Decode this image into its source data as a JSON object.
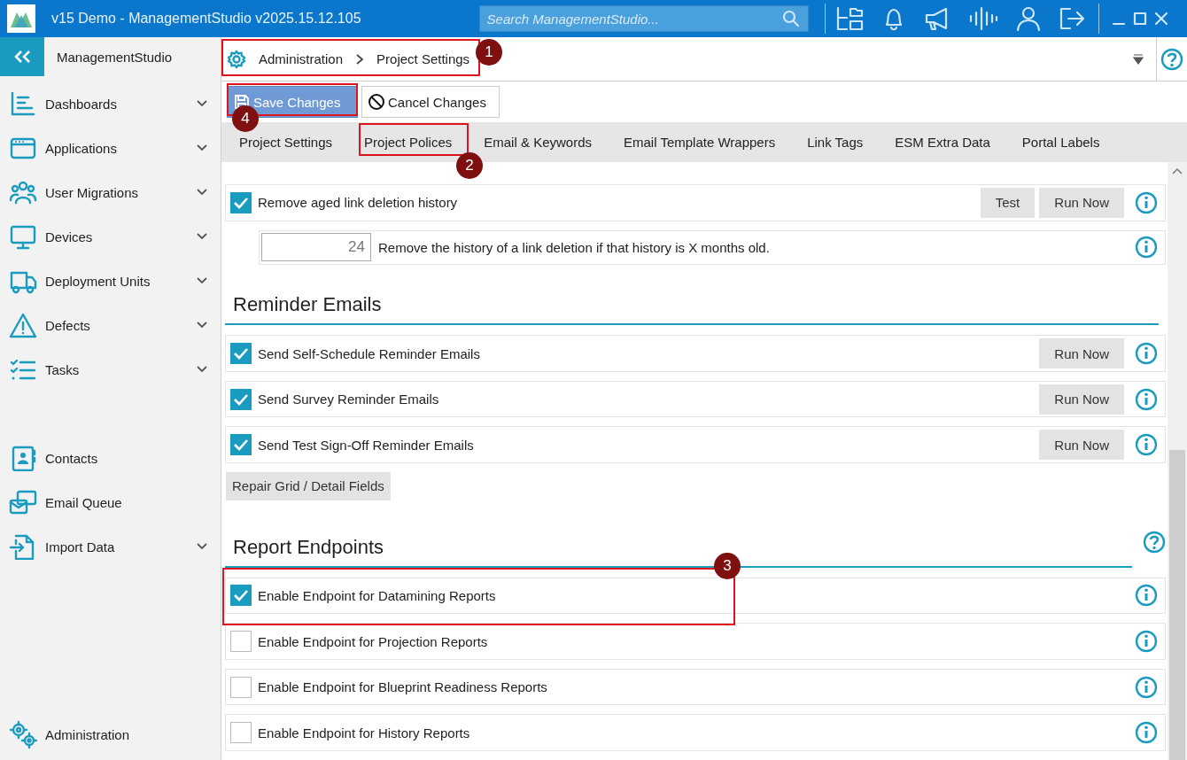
{
  "window": {
    "title": "v15 Demo - ManagementStudio v2025.15.12.105"
  },
  "search": {
    "placeholder": "Search ManagementStudio..."
  },
  "sidebar": {
    "header": "ManagementStudio",
    "items": [
      {
        "label": "Dashboards",
        "expandable": true
      },
      {
        "label": "Applications",
        "expandable": true
      },
      {
        "label": "User Migrations",
        "expandable": true
      },
      {
        "label": "Devices",
        "expandable": true
      },
      {
        "label": "Deployment Units",
        "expandable": true
      },
      {
        "label": "Defects",
        "expandable": true
      },
      {
        "label": "Tasks",
        "expandable": true
      }
    ],
    "lower_items": [
      {
        "label": "Contacts",
        "expandable": false
      },
      {
        "label": "Email Queue",
        "expandable": false
      },
      {
        "label": "Import Data",
        "expandable": true
      }
    ],
    "footer": "Administration"
  },
  "breadcrumb": [
    "Administration",
    "Project Settings"
  ],
  "toolbar": [
    "Save Changes",
    "Cancel Changes"
  ],
  "tabs": [
    {
      "label": "Project Settings"
    },
    {
      "label": "Project Polices"
    },
    {
      "label": "Email & Keywords"
    },
    {
      "label": "Email Template Wrappers"
    },
    {
      "label": "Link Tags"
    },
    {
      "label": "ESM Extra Data"
    },
    {
      "label": "Portal Labels"
    }
  ],
  "content": [
    {
      "kind": "checkbox",
      "label": "Remove aged link deletion history",
      "checked": true,
      "buttons": [
        "Test",
        "Run Now"
      ]
    },
    {
      "kind": "number",
      "value": "24",
      "label": "Remove the history of a link deletion if that history is X months old."
    },
    {
      "kind": "heading",
      "label": "Reminder Emails",
      "help": false
    },
    {
      "kind": "checkbox",
      "label": "Send Self-Schedule Reminder Emails",
      "checked": true,
      "buttons": [
        "Run Now"
      ]
    },
    {
      "kind": "checkbox",
      "label": "Send Survey Reminder Emails",
      "checked": true,
      "buttons": [
        "Run Now"
      ]
    },
    {
      "kind": "checkbox",
      "label": "Send Test Sign-Off Reminder Emails",
      "checked": true,
      "buttons": [
        "Run Now"
      ]
    },
    {
      "kind": "button",
      "label": "Repair Grid / Detail Fields"
    },
    {
      "kind": "heading",
      "label": "Report Endpoints",
      "help": true
    },
    {
      "kind": "checkbox",
      "label": "Enable Endpoint for Datamining Reports",
      "checked": true
    },
    {
      "kind": "checkbox",
      "label": "Enable Endpoint for Projection Reports",
      "checked": false
    },
    {
      "kind": "checkbox",
      "label": "Enable Endpoint for Blueprint Readiness Reports",
      "checked": false
    },
    {
      "kind": "checkbox",
      "label": "Enable Endpoint for History Reports",
      "checked": false
    }
  ],
  "annotations": [
    "1",
    "2",
    "3",
    "4"
  ]
}
